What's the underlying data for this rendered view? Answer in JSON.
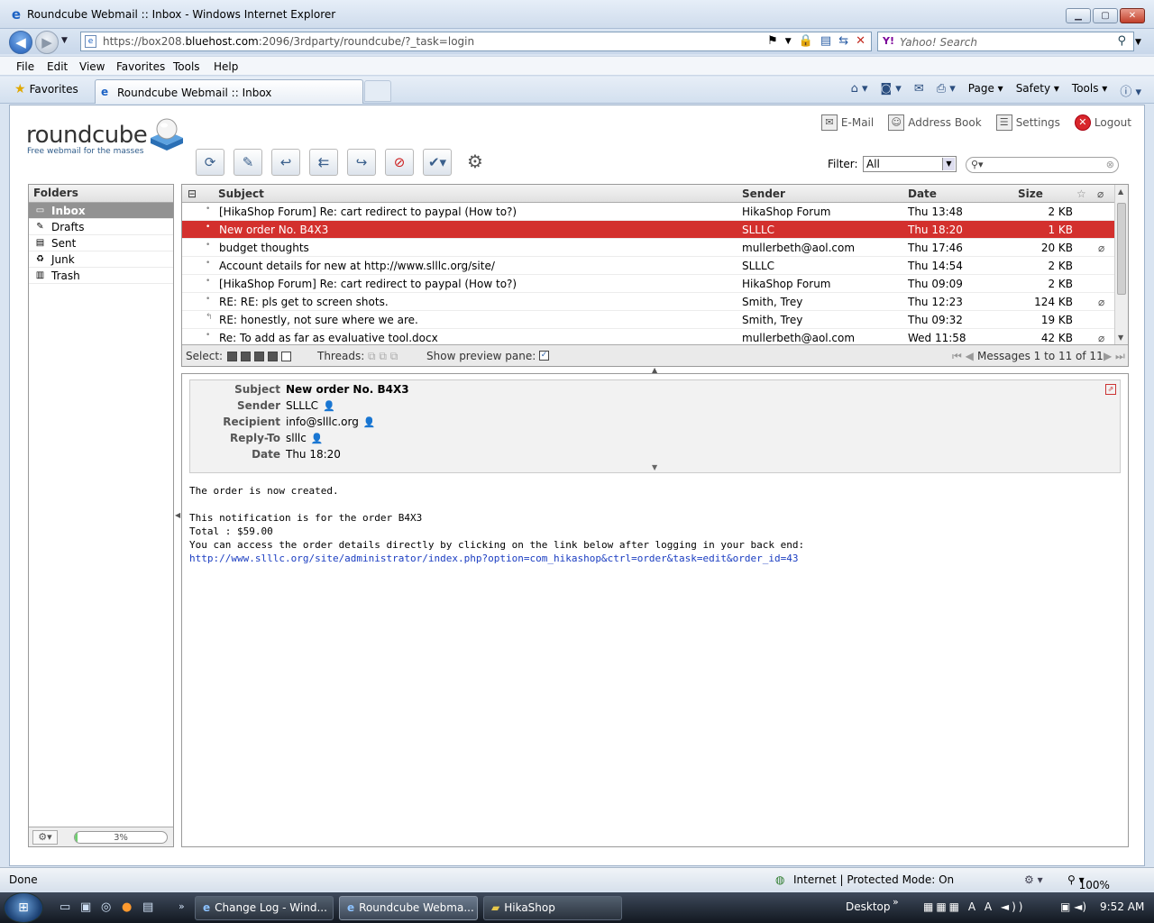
{
  "window": {
    "title": "Roundcube Webmail :: Inbox - Windows Internet Explorer",
    "url_prefix": "https://box208.",
    "url_host": "bluehost.com",
    "url_rest": ":2096/3rdparty/roundcube/?_task=login",
    "search_placeholder": "Yahoo! Search",
    "search_logo": "Y!"
  },
  "menu": [
    "File",
    "Edit",
    "View",
    "Favorites",
    "Tools",
    "Help"
  ],
  "tabs": {
    "favorites_label": "Favorites",
    "active_tab": "Roundcube Webmail :: Inbox",
    "commands": [
      "Page",
      "Safety",
      "Tools"
    ]
  },
  "app": {
    "logo_text": "roundcube",
    "logo_tagline": "Free webmail for the masses",
    "nav": [
      "E-Mail",
      "Address Book",
      "Settings",
      "Logout"
    ],
    "filter_label": "Filter:",
    "filter_value": "All"
  },
  "folders": {
    "title": "Folders",
    "items": [
      {
        "label": "Inbox",
        "icon": "inbox-icon",
        "glyph": "▭"
      },
      {
        "label": "Drafts",
        "icon": "pencil-icon",
        "glyph": "✎"
      },
      {
        "label": "Sent",
        "icon": "sent-icon",
        "glyph": "▤"
      },
      {
        "label": "Junk",
        "icon": "junk-icon",
        "glyph": "♻"
      },
      {
        "label": "Trash",
        "icon": "trash-icon",
        "glyph": "▥"
      }
    ],
    "selected": 0,
    "quota_text": "3%",
    "quota_fraction": 0.03
  },
  "message_list": {
    "columns": {
      "subject": "Subject",
      "sender": "Sender",
      "date": "Date",
      "size": "Size"
    },
    "selected": 1,
    "rows": [
      {
        "subject": "[HikaShop Forum] Re: cart redirect to paypal (How to?)",
        "sender": "HikaShop Forum",
        "date": "Thu 13:48",
        "size": "2 KB",
        "attachment": false,
        "status": "•"
      },
      {
        "subject": "New order No. B4X3",
        "sender": "SLLLC",
        "date": "Thu 18:20",
        "size": "1 KB",
        "attachment": false,
        "status": "•"
      },
      {
        "subject": "budget thoughts",
        "sender": "mullerbeth@aol.com",
        "date": "Thu 17:46",
        "size": "20 KB",
        "attachment": true,
        "status": "•"
      },
      {
        "subject": "Account details for new at http://www.slllc.org/site/",
        "sender": "SLLLC",
        "date": "Thu 14:54",
        "size": "2 KB",
        "attachment": false,
        "status": "•"
      },
      {
        "subject": "[HikaShop Forum] Re: cart redirect to paypal (How to?)",
        "sender": "HikaShop Forum",
        "date": "Thu 09:09",
        "size": "2 KB",
        "attachment": false,
        "status": "•"
      },
      {
        "subject": "RE: RE: pls get to screen shots.",
        "sender": "Smith, Trey",
        "date": "Thu 12:23",
        "size": "124 KB",
        "attachment": true,
        "status": "•"
      },
      {
        "subject": "RE: honestly, not sure where we are.",
        "sender": "Smith, Trey",
        "date": "Thu 09:32",
        "size": "19 KB",
        "attachment": false,
        "status": "↰"
      },
      {
        "subject": "Re: To add as far as evaluative tool.docx",
        "sender": "mullerbeth@aol.com",
        "date": "Wed 11:58",
        "size": "42 KB",
        "attachment": true,
        "status": "•"
      }
    ],
    "footer": {
      "select_label": "Select:",
      "threads_label": "Threads:",
      "preview_label": "Show preview pane:",
      "count_text": "Messages 1 to 11 of 11"
    }
  },
  "preview": {
    "labels": {
      "subject": "Subject",
      "sender": "Sender",
      "recipient": "Recipient",
      "replyto": "Reply-To",
      "date": "Date"
    },
    "subject": "New order No. B4X3",
    "sender": "SLLLC",
    "recipient": "info@slllc.org",
    "replyto": "slllc",
    "date": "Thu 18:20",
    "body_line1": "The order is now created.",
    "body_line2": "This notification is for the order B4X3",
    "body_line3": "Total : $59.00",
    "body_line4": "You can access the order details directly by clicking on the link below after logging in your back end:",
    "body_link": "http://www.slllc.org/site/administrator/index.php?option=com_hikashop&ctrl=order&task=edit&order_id=43"
  },
  "statusbar": {
    "left": "Done",
    "zone": "Internet | Protected Mode: On",
    "zoom": "100%"
  },
  "taskbar": {
    "items": [
      "Change Log - Wind...",
      "Roundcube Webma...",
      "HikaShop"
    ],
    "desktop": "Desktop",
    "clock": "9:52 AM"
  },
  "colors": {
    "selected_row": "#d3302d",
    "folder_selected": "#929292",
    "link": "#1a3dc1"
  }
}
